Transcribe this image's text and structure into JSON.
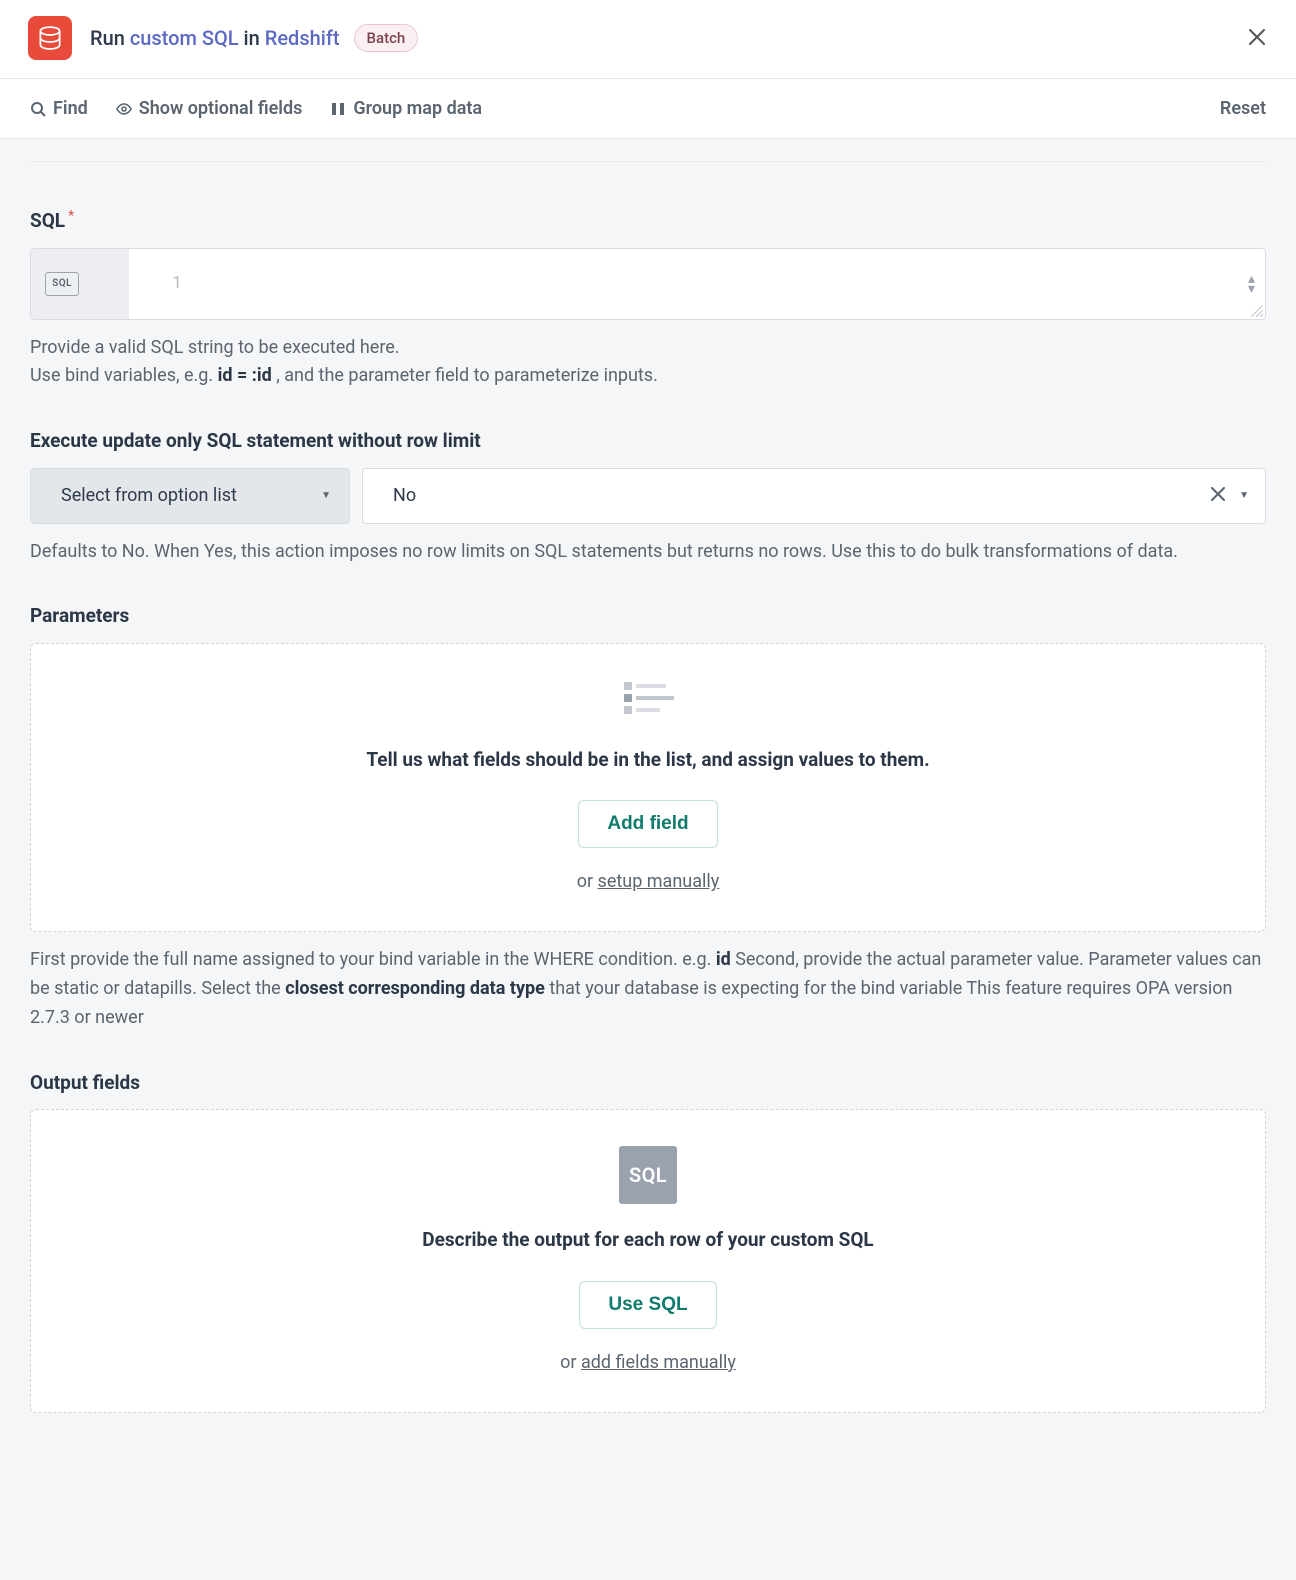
{
  "header": {
    "title_prefix": "Run",
    "title_link1": "custom SQL",
    "title_middle": "in",
    "title_link2": "Redshift",
    "badge": "Batch"
  },
  "toolbar": {
    "find": "Find",
    "show_optional": "Show optional fields",
    "group_map": "Group map data",
    "reset": "Reset"
  },
  "sql": {
    "label": "SQL",
    "lang_box": "SQL",
    "line_number": "1",
    "help1": "Provide a valid SQL string to be executed here.",
    "help2a": "Use bind variables, e.g. ",
    "help2b": "id = :id",
    "help2c": " , and the parameter field to parameterize inputs."
  },
  "execute_update": {
    "label": "Execute update only SQL statement without row limit",
    "select_label": "Select from option list",
    "value": "No",
    "help": "Defaults to No. When Yes, this action imposes no row limits on SQL statements but returns no rows. Use this to do bulk transformations of data."
  },
  "parameters": {
    "label": "Parameters",
    "empty_headline": "Tell us what fields should be in the list, and assign values to them.",
    "add_button": "Add field",
    "or_prefix": "or ",
    "or_link": "setup manually",
    "help_a": "First provide the full name assigned to your bind variable in the WHERE condition. e.g. ",
    "help_b": "id",
    "help_c": " Second, provide the actual parameter value. Parameter values can be static or datapills. Select the ",
    "help_d": "closest corresponding data type",
    "help_e": " that your database is expecting for the bind variable This feature requires OPA version 2.7.3 or newer"
  },
  "output_fields": {
    "label": "Output fields",
    "icon_text": "SQL",
    "headline": "Describe the output for each row of your custom SQL",
    "button": "Use SQL",
    "or_prefix": "or ",
    "or_link": "add fields manually"
  }
}
